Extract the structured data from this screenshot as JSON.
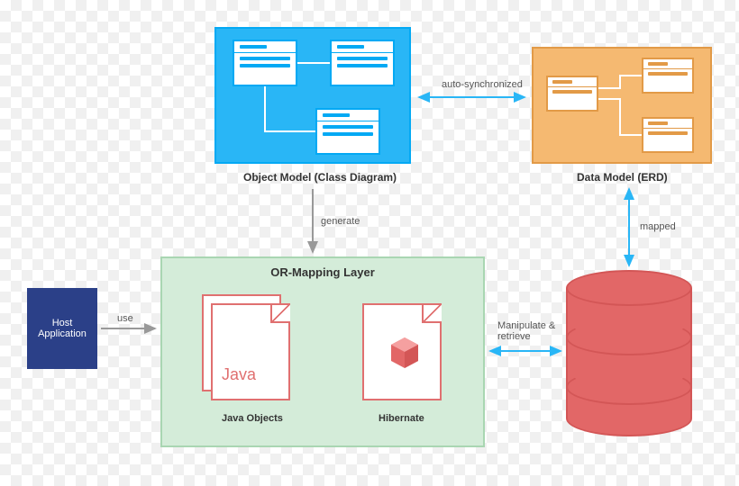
{
  "object_model": {
    "caption": "Object Model (Class Diagram)"
  },
  "data_model": {
    "caption": "Data Model (ERD)"
  },
  "arrows": {
    "auto_sync": "auto-synchronized",
    "generate": "generate",
    "mapped": "mapped",
    "use": "use",
    "manipulate": "Manipulate & retrieve"
  },
  "host_app": {
    "label": "Host Application"
  },
  "or_layer": {
    "title": "OR-Mapping Layer",
    "java_objects": {
      "label": "Java Objects",
      "badge": "Java"
    },
    "hibernate": {
      "label": "Hibernate"
    }
  },
  "colors": {
    "blue": "#29b6f6",
    "orange": "#f5b971",
    "navy": "#2b4088",
    "green": "#d4ecd9",
    "red": "#e26767"
  }
}
